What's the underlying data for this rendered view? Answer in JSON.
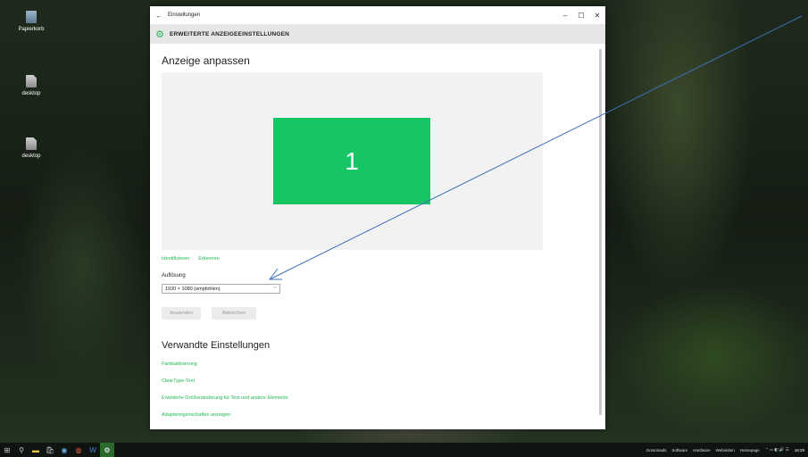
{
  "desktop": {
    "icons": [
      {
        "label": "Papierkorb"
      },
      {
        "label": "desktop"
      },
      {
        "label": "desktop"
      }
    ]
  },
  "window": {
    "app_title": "Einstellungen",
    "controls": {
      "minimize": "–",
      "maximize": "☐",
      "close": "✕"
    },
    "back": "←",
    "header_title": "ERWEITERTE ANZEIGEEINSTELLUNGEN",
    "page_title": "Anzeige anpassen",
    "monitor_number": "1",
    "links": {
      "identify": "Identifizieren",
      "detect": "Erkennen"
    },
    "resolution": {
      "label": "Auflösung",
      "selected": "1920 × 1080 (empfohlen)"
    },
    "buttons": {
      "apply": "Anwenden",
      "cancel": "Abbrechen"
    },
    "related": {
      "title": "Verwandte Einstellungen",
      "items": [
        "Farbkalibrierung",
        "ClearType-Text",
        "Erweiterte Größenänderung für Text und andere Elemente",
        "Adaptereigenschaften anzeigen"
      ]
    }
  },
  "taskbar": {
    "toolbars": [
      "Downloads",
      "Software",
      "Hardware",
      "Webseiten",
      "Homepage"
    ],
    "clock": {
      "time": "16:29"
    }
  },
  "colors": {
    "accent": "#1db954",
    "monitor": "#17c564",
    "annotation": "#3e6fb8"
  }
}
